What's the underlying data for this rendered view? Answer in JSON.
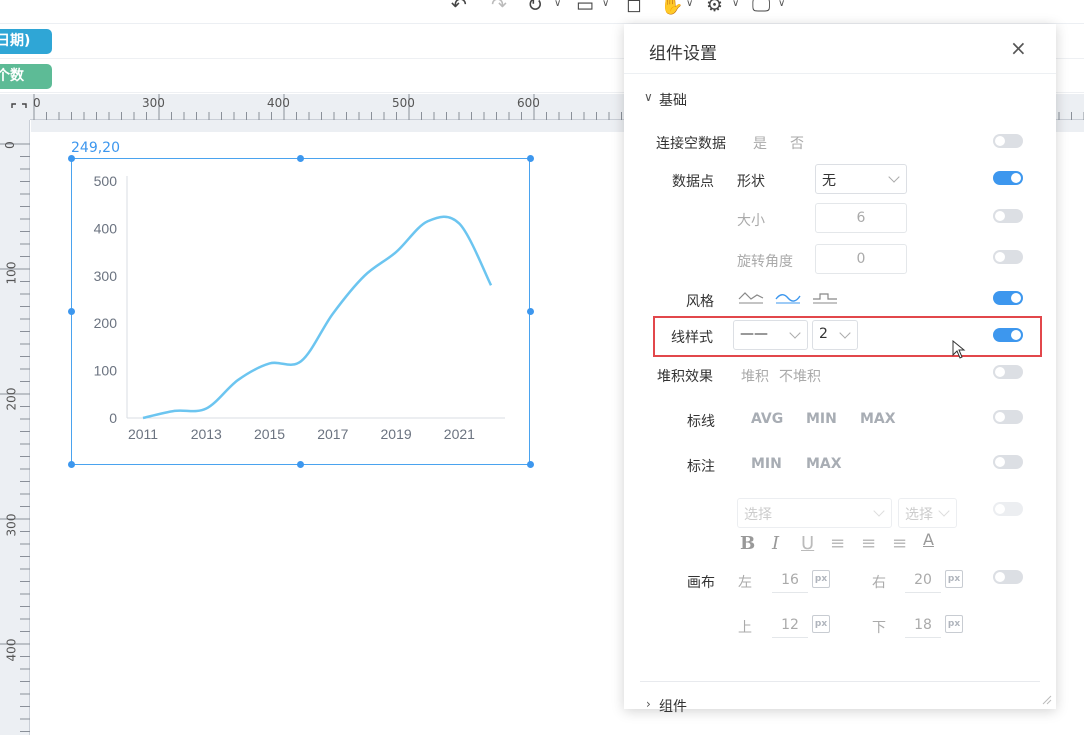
{
  "toolbar": {
    "icons": [
      "undo-icon",
      "redo-icon",
      "refresh-icon",
      "save-icon",
      "preview-icon",
      "hand-icon",
      "settings-icon",
      "monitor-icon"
    ]
  },
  "left_chips": [
    {
      "text": "日期)",
      "color": "#2fa6d6"
    },
    {
      "text": "个数",
      "color": "#5dbb96"
    }
  ],
  "ruler": {
    "top_labels": [
      "0",
      "300",
      "400",
      "500",
      "600"
    ],
    "left_labels": [
      "0",
      "100",
      "200",
      "300",
      "400"
    ]
  },
  "chart_selection": {
    "position_label": "249,20"
  },
  "chart_data": {
    "type": "line",
    "x": [
      2011,
      2012,
      2013,
      2014,
      2015,
      2016,
      2017,
      2018,
      2019,
      2020,
      2021,
      2022
    ],
    "x_tick_labels": [
      "2011",
      "2013",
      "2015",
      "2017",
      "2019",
      "2021"
    ],
    "y_tick_labels": [
      "0",
      "100",
      "200",
      "300",
      "400",
      "500"
    ],
    "values": [
      0,
      15,
      20,
      80,
      115,
      120,
      220,
      300,
      350,
      415,
      410,
      280
    ],
    "ylim": [
      0,
      500
    ],
    "line_color": "#6cc5f0",
    "smooth": true,
    "grid": false
  },
  "panel": {
    "title": "组件设置",
    "section_basic": "基础",
    "section_component": "组件",
    "connect_null": {
      "label": "连接空数据",
      "opt_yes": "是",
      "opt_no": "否",
      "enabled": false
    },
    "data_point": {
      "label": "数据点",
      "shape_label": "形状",
      "shape_value": "无",
      "enabled": true,
      "size_label": "大小",
      "size_value": "6",
      "size_enabled": false,
      "rotate_label": "旋转角度",
      "rotate_value": "0",
      "rotate_enabled": false
    },
    "style": {
      "label": "风格",
      "enabled": true
    },
    "line_style": {
      "label": "线样式",
      "value": "——",
      "width_value": "2",
      "enabled": true
    },
    "stack": {
      "label": "堆积效果",
      "opt_stack": "堆积",
      "opt_nostack": "不堆积",
      "enabled": false
    },
    "mark_line": {
      "label": "标线",
      "opts": [
        "AVG",
        "MIN",
        "MAX"
      ],
      "enabled": false
    },
    "mark_point": {
      "label": "标注",
      "opts": [
        "MIN",
        "MAX"
      ],
      "enabled": false
    },
    "font_select_placeholder": "选择",
    "font_size_placeholder": "选择",
    "format_buttons": [
      "B",
      "I",
      "U",
      "≡",
      "≡",
      "≡",
      "A"
    ],
    "canvas": {
      "label": "画布",
      "left_label": "左",
      "left_value": "16",
      "right_label": "右",
      "right_value": "20",
      "top_label": "上",
      "top_value": "12",
      "bottom_label": "下",
      "bottom_value": "18",
      "px": "px",
      "enabled": false
    }
  }
}
